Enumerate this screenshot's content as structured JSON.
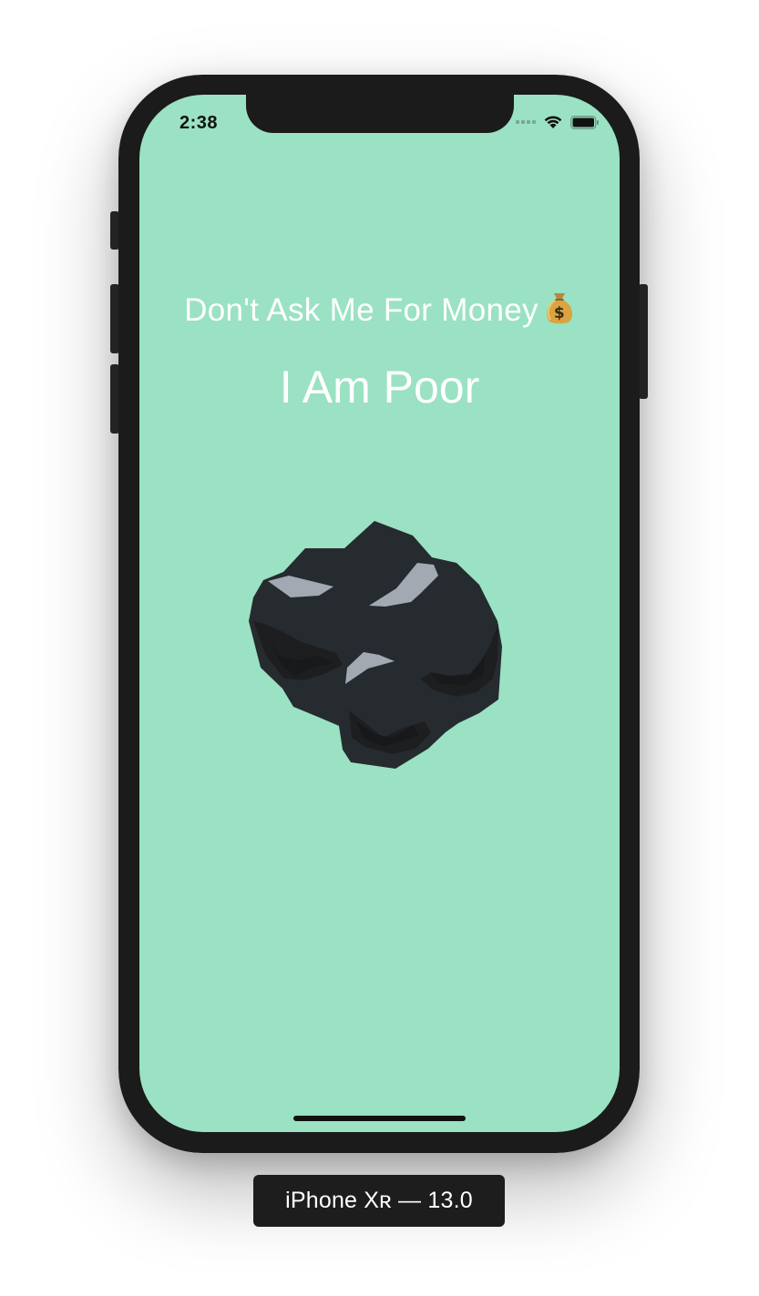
{
  "device": {
    "label": "iPhone Xʀ — 13.0"
  },
  "status_bar": {
    "time": "2:38",
    "icons": [
      "cellular-signal-icon",
      "wifi-icon",
      "battery-icon"
    ]
  },
  "app": {
    "background_color": "#9ae2c3",
    "subtitle": "Don't Ask Me For Money",
    "subtitle_icon": "money-bag-icon",
    "title": "I Am Poor",
    "image": "coal-image"
  }
}
